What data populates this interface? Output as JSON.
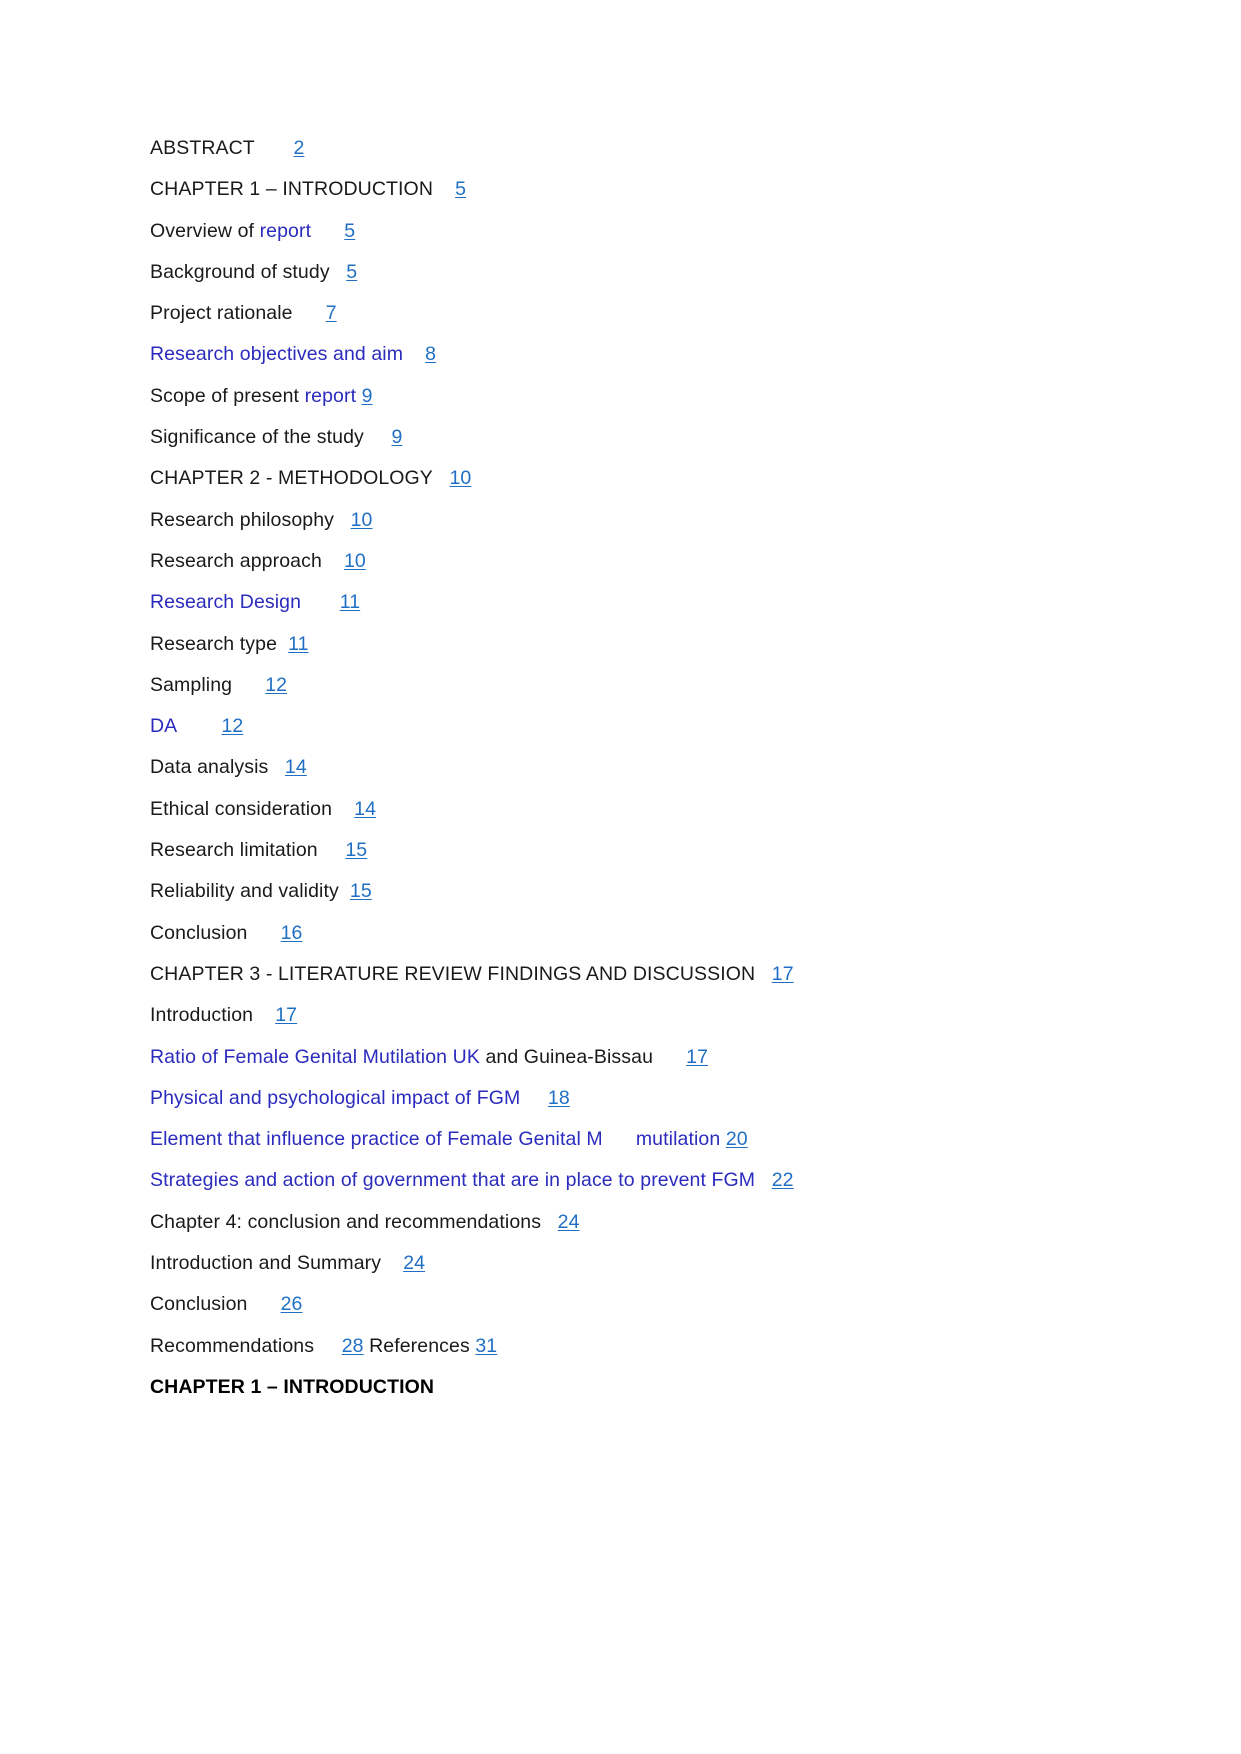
{
  "document": {
    "type": "table-of-contents",
    "page_background": "#ffffff",
    "colors": {
      "body_text": "#1a1a1a",
      "hyperlink_text": "#2b2bbd",
      "page_number_link": "#1f6fc4"
    },
    "entries": [
      {
        "id": "abstract",
        "segments": [
          {
            "text": "ABSTRACT",
            "style": "black"
          }
        ],
        "gap": 7,
        "page": "2"
      },
      {
        "id": "chapter-1-introduction",
        "segments": [
          {
            "text": "CHAPTER 1 – INTRODUCTION",
            "style": "black"
          }
        ],
        "gap": 4,
        "page": "5"
      },
      {
        "id": "overview-of-report",
        "segments": [
          {
            "text": "Overview of ",
            "style": "black"
          },
          {
            "text": "report",
            "style": "blue"
          }
        ],
        "gap": 6,
        "page": "5"
      },
      {
        "id": "background-of-study",
        "segments": [
          {
            "text": "Background of study",
            "style": "black"
          }
        ],
        "gap": 3,
        "page": "5"
      },
      {
        "id": "project-rationale",
        "segments": [
          {
            "text": "Project rationale",
            "style": "black"
          }
        ],
        "gap": 6,
        "page": "7"
      },
      {
        "id": "research-objectives-and-aim",
        "segments": [
          {
            "text": "Research objectives and aim",
            "style": "blue"
          }
        ],
        "gap": 4,
        "page": "8"
      },
      {
        "id": "scope-of-present-report",
        "segments": [
          {
            "text": "Scope of present ",
            "style": "black"
          },
          {
            "text": "report",
            "style": "blue"
          }
        ],
        "gap": 1,
        "page": "9"
      },
      {
        "id": "significance-of-the-study",
        "segments": [
          {
            "text": "Significance of the study",
            "style": "black"
          }
        ],
        "gap": 5,
        "page": "9"
      },
      {
        "id": "chapter-2-methodology",
        "segments": [
          {
            "text": "CHAPTER 2 - METHODOLOGY",
            "style": "black"
          }
        ],
        "gap": 3,
        "page": "10"
      },
      {
        "id": "research-philosophy",
        "segments": [
          {
            "text": "Research philosophy",
            "style": "black"
          }
        ],
        "gap": 3,
        "page": "10"
      },
      {
        "id": "research-approach",
        "segments": [
          {
            "text": "Research approach",
            "style": "black"
          }
        ],
        "gap": 4,
        "page": "10"
      },
      {
        "id": "research-design",
        "segments": [
          {
            "text": "Research Design",
            "style": "blue"
          }
        ],
        "gap": 7,
        "page": "11"
      },
      {
        "id": "research-type",
        "segments": [
          {
            "text": "Research type",
            "style": "black"
          }
        ],
        "gap": 2,
        "page": "11"
      },
      {
        "id": "sampling",
        "segments": [
          {
            "text": "Sampling",
            "style": "black"
          }
        ],
        "gap": 6,
        "page": "12"
      },
      {
        "id": "da",
        "segments": [
          {
            "text": "DA",
            "style": "blue"
          }
        ],
        "gap": 8,
        "page": "12"
      },
      {
        "id": "data-analysis",
        "segments": [
          {
            "text": "Data analysis",
            "style": "black"
          }
        ],
        "gap": 3,
        "page": "14"
      },
      {
        "id": "ethical-consideration",
        "segments": [
          {
            "text": "Ethical consideration",
            "style": "black"
          }
        ],
        "gap": 4,
        "page": "14"
      },
      {
        "id": "research-limitation",
        "segments": [
          {
            "text": "Research limitation",
            "style": "black"
          }
        ],
        "gap": 5,
        "page": "15"
      },
      {
        "id": "reliability-and-validity",
        "segments": [
          {
            "text": "Reliability and validity",
            "style": "black"
          }
        ],
        "gap": 2,
        "page": "15"
      },
      {
        "id": "conclusion-ch2",
        "segments": [
          {
            "text": "Conclusion",
            "style": "black"
          }
        ],
        "gap": 6,
        "page": "16"
      },
      {
        "id": "chapter-3-literature-review",
        "segments": [
          {
            "text": "CHAPTER 3 - LITERATURE REVIEW FINDINGS AND DISCUSSION",
            "style": "black"
          }
        ],
        "gap": 3,
        "page": "17"
      },
      {
        "id": "introduction-ch3",
        "segments": [
          {
            "text": "Introduction",
            "style": "black"
          }
        ],
        "gap": 4,
        "page": "17"
      },
      {
        "id": "ratio-of-fgm-uk-guinea-bissau",
        "segments": [
          {
            "text": "Ratio of Female Genital Mutilation UK",
            "style": "blue"
          },
          {
            "text": " and Guinea-Bissau",
            "style": "black"
          }
        ],
        "gap": 6,
        "page": "17"
      },
      {
        "id": "physical-and-psychological-impact",
        "segments": [
          {
            "text": "Physical and psychological impact of FGM",
            "style": "blue"
          }
        ],
        "gap": 5,
        "page": "18"
      },
      {
        "id": "element-that-influence-practice",
        "segments": [
          {
            "text": "Element that influence practice of Female Genital M",
            "style": "blue"
          },
          {
            "text": "      mutilation ",
            "style": "blue"
          }
        ],
        "gap": 0,
        "page": "20"
      },
      {
        "id": "strategies-and-action-of-government",
        "segments": [
          {
            "text": "Strategies and action of government that are in place to prevent FGM",
            "style": "blue"
          }
        ],
        "gap": 3,
        "page": "22"
      },
      {
        "id": "chapter-4-conclusion-recommendations",
        "segments": [
          {
            "text": "Chapter 4: conclusion and recommendations",
            "style": "black"
          }
        ],
        "gap": 3,
        "page": "24"
      },
      {
        "id": "introduction-and-summary",
        "segments": [
          {
            "text": "Introduction and Summary",
            "style": "black"
          }
        ],
        "gap": 4,
        "page": "24"
      },
      {
        "id": "conclusion-ch4",
        "segments": [
          {
            "text": "Conclusion",
            "style": "black"
          }
        ],
        "gap": 6,
        "page": "26"
      },
      {
        "id": "recommendations-references",
        "segments": [
          {
            "text": "Recommendations",
            "style": "black"
          }
        ],
        "gap": 5,
        "page": "28",
        "trailing_segments": [
          {
            "text": " References ",
            "style": "black"
          }
        ],
        "trailing_page": "31"
      }
    ],
    "final_heading": "CHAPTER 1 – INTRODUCTION"
  }
}
